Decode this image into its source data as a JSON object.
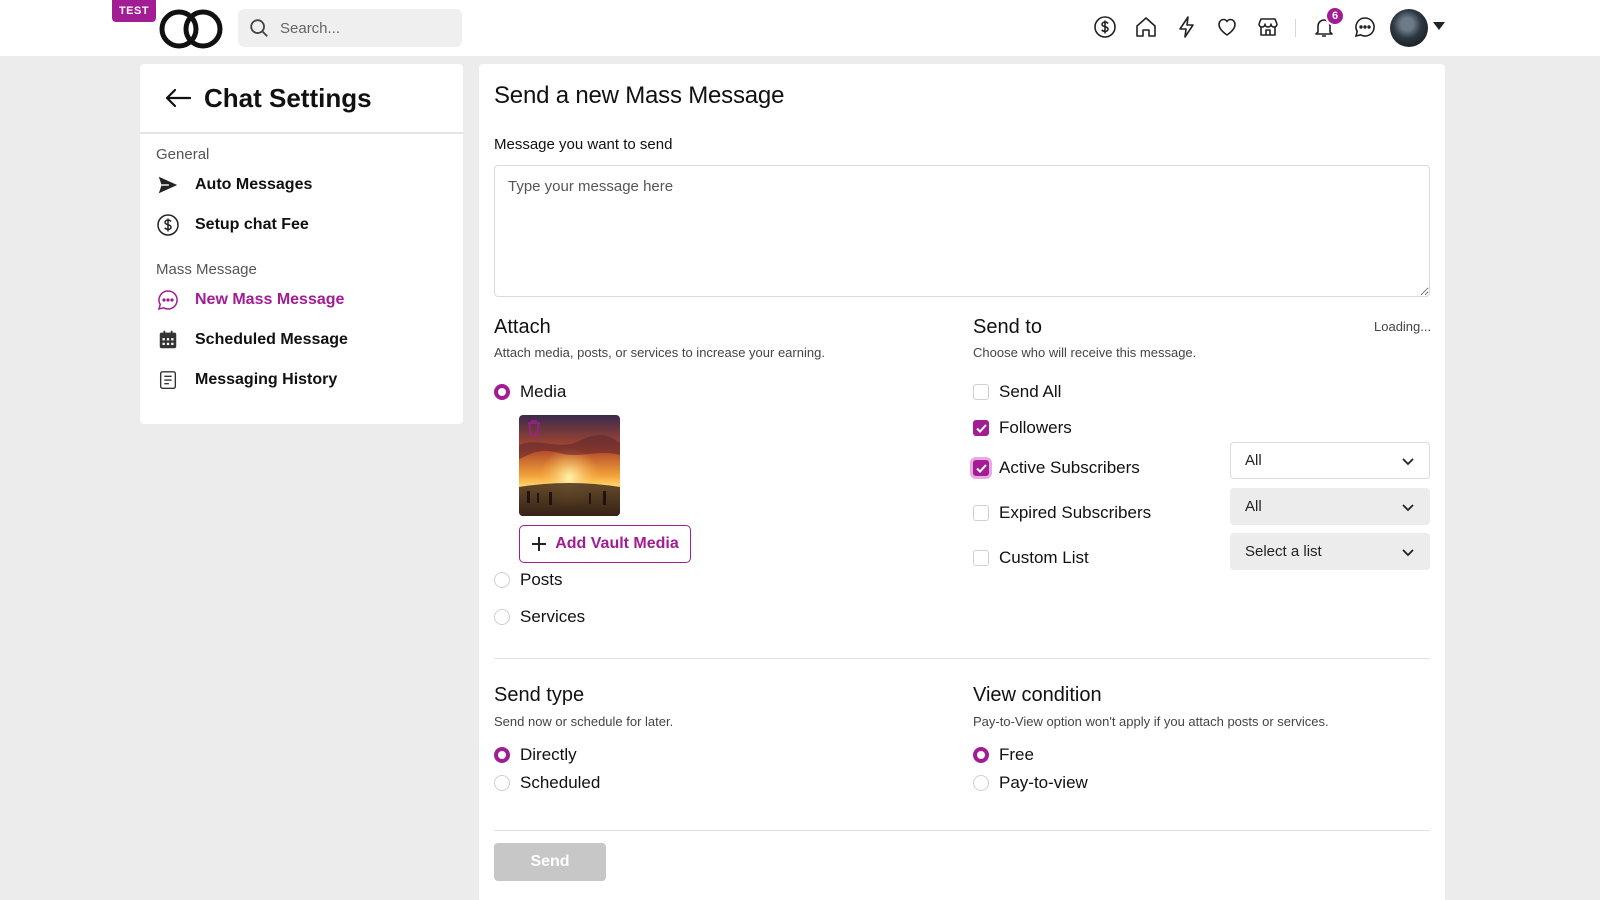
{
  "nav": {
    "badge": "TEST",
    "search_placeholder": "Search...",
    "notification_count": "6",
    "icons": [
      "dollar-icon",
      "home-icon",
      "lightning-icon",
      "heart-icon",
      "store-icon",
      "bell-icon",
      "chat-icon"
    ]
  },
  "sidebar": {
    "title": "Chat Settings",
    "sections": [
      {
        "label": "General",
        "items": [
          {
            "label": "Auto Messages",
            "icon": "send-icon"
          },
          {
            "label": "Setup chat Fee",
            "icon": "dollar-icon"
          }
        ]
      },
      {
        "label": "Mass Message",
        "items": [
          {
            "label": "New Mass Message",
            "icon": "chat-bubble-icon",
            "active": true
          },
          {
            "label": "Scheduled Message",
            "icon": "calendar-icon"
          },
          {
            "label": "Messaging History",
            "icon": "document-icon"
          }
        ]
      }
    ]
  },
  "main": {
    "title": "Send a new Mass Message",
    "message_label": "Message you want to send",
    "message_placeholder": "Type your message here",
    "message_value": "",
    "attach": {
      "title": "Attach",
      "subtitle": "Attach media, posts, or services to increase your earning.",
      "options": [
        "Media",
        "Posts",
        "Services"
      ],
      "selected": "Media",
      "vault_button": "Add Vault Media"
    },
    "send_to": {
      "title": "Send to",
      "subtitle": "Choose who will receive this message.",
      "loading": "Loading...",
      "options": [
        {
          "label": "Send All",
          "checked": false
        },
        {
          "label": "Followers",
          "checked": true
        },
        {
          "label": "Active Subscribers",
          "checked": true,
          "select": "All"
        },
        {
          "label": "Expired Subscribers",
          "checked": false,
          "select": "All"
        },
        {
          "label": "Custom List",
          "checked": false,
          "select": "Select a list"
        }
      ]
    },
    "send_type": {
      "title": "Send type",
      "subtitle": "Send now or schedule for later.",
      "options": [
        "Directly",
        "Scheduled"
      ],
      "selected": "Directly"
    },
    "view_condition": {
      "title": "View condition",
      "subtitle": "Pay-to-View option won't apply if you attach posts or services.",
      "options": [
        "Free",
        "Pay-to-view"
      ],
      "selected": "Free"
    },
    "send_button": "Send"
  },
  "colors": {
    "accent": "#a21c94",
    "background": "#ececec",
    "disabled_button": "#c7c7c7"
  }
}
